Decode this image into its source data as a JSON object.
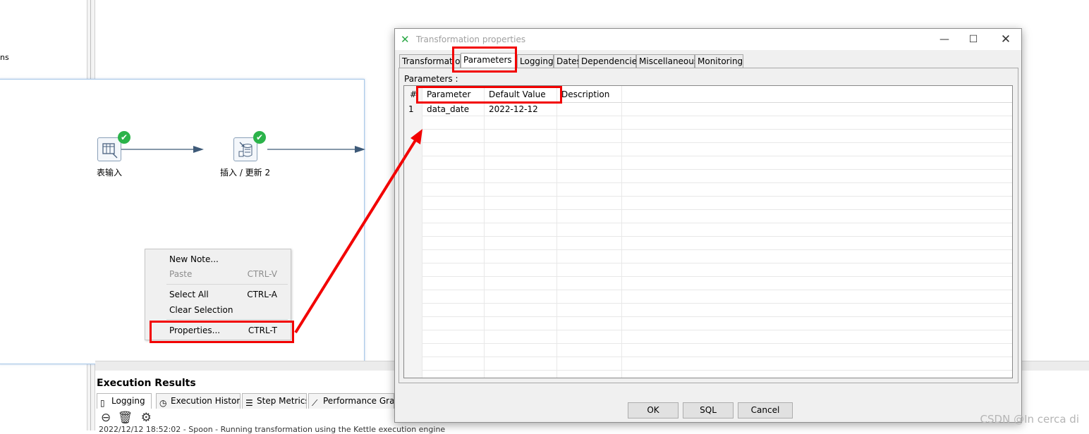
{
  "left_tree": {
    "fragment_text": "ns"
  },
  "canvas": {
    "steps": [
      {
        "label": "表输入",
        "status": "✔"
      },
      {
        "label": "插入 / 更新 2",
        "status": "✔"
      }
    ]
  },
  "context_menu": {
    "items": [
      {
        "label": "New Note...",
        "shortcut": ""
      },
      {
        "label": "Paste",
        "shortcut": "CTRL-V"
      },
      {
        "label": "Select All",
        "shortcut": "CTRL-A"
      },
      {
        "label": "Clear Selection",
        "shortcut": ""
      },
      {
        "label": "Properties...",
        "shortcut": "CTRL-T"
      }
    ]
  },
  "execution": {
    "title": "Execution Results",
    "tabs": [
      "Logging",
      "Execution History",
      "Step Metrics",
      "Performance Graph"
    ],
    "log_line": "2022/12/12 18:52:02 - Spoon - Running transformation using the Kettle execution engine"
  },
  "dialog": {
    "title": "Transformation properties",
    "tabs": [
      "Transformation",
      "Parameters",
      "Logging",
      "Dates",
      "Dependencies",
      "Miscellaneous",
      "Monitoring"
    ],
    "active_tab": "Parameters",
    "panel_label": "Parameters :",
    "columns": [
      "#",
      "Parameter",
      "Default Value",
      "Description"
    ],
    "rows": [
      {
        "num": "1",
        "parameter": "data_date",
        "default_value": "2022-12-12",
        "description": ""
      }
    ],
    "buttons": {
      "ok": "OK",
      "sql": "SQL",
      "cancel": "Cancel"
    }
  },
  "watermark": "CSDN @In cerca di",
  "colors": {
    "annotation_red": "#f20000",
    "check_green": "#2bb34a",
    "link_line": "#3e5a78"
  }
}
